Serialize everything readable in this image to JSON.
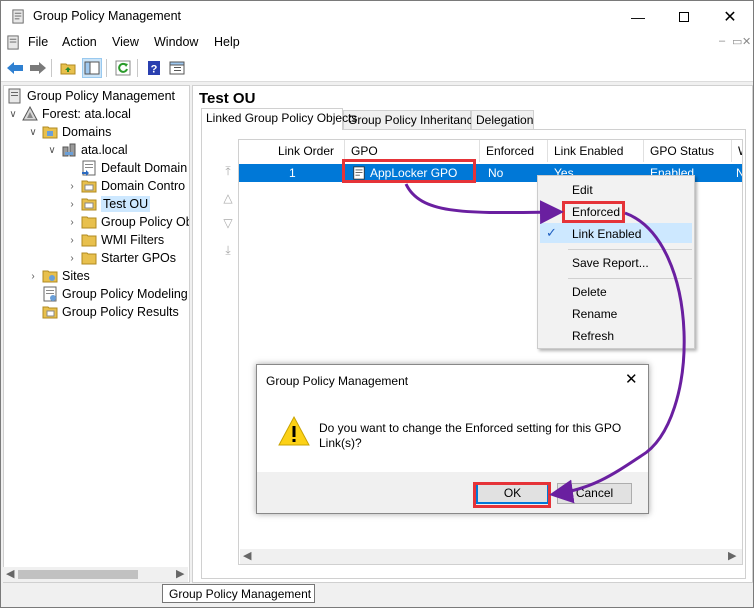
{
  "window": {
    "title": "Group Policy Management"
  },
  "menu": [
    "File",
    "Action",
    "View",
    "Window",
    "Help"
  ],
  "tree": [
    {
      "label": "Group Policy Management",
      "icon": "gpm-icon"
    },
    {
      "label": "Forest: ata.local",
      "icon": "forest-icon"
    },
    {
      "label": "Domains",
      "icon": "folder-icon"
    },
    {
      "label": "ata.local",
      "icon": "domain-icon"
    },
    {
      "label": "Default Domain",
      "icon": "gpo-link-icon"
    },
    {
      "label": "Domain Contro",
      "icon": "ou-icon"
    },
    {
      "label": "Test OU",
      "icon": "ou-icon"
    },
    {
      "label": "Group Policy Ob",
      "icon": "folder-icon"
    },
    {
      "label": "WMI Filters",
      "icon": "folder-icon"
    },
    {
      "label": "Starter GPOs",
      "icon": "folder-icon"
    },
    {
      "label": "Sites",
      "icon": "sites-icon"
    },
    {
      "label": "Group Policy Modeling",
      "icon": "modeling-icon"
    },
    {
      "label": "Group Policy Results",
      "icon": "results-icon"
    }
  ],
  "right": {
    "title": "Test OU",
    "tabs": [
      "Linked Group Policy Objects",
      "Group Policy Inheritance",
      "Delegation"
    ],
    "columns": [
      "Link Order",
      "GPO",
      "Enforced",
      "Link Enabled",
      "GPO Status",
      "W"
    ],
    "row": {
      "link_order": "1",
      "gpo": "AppLocker GPO",
      "enforced": "No",
      "link_enabled": "Yes",
      "gpo_status": "Enabled",
      "w": "N"
    }
  },
  "context_menu": {
    "items": [
      "Edit",
      "Enforced",
      "Link Enabled",
      "Save Report...",
      "Delete",
      "Rename",
      "Refresh"
    ],
    "checked": "Link Enabled"
  },
  "dialog": {
    "title": "Group Policy Management",
    "message": "Do you want to change the Enforced setting for this GPO Link(s)?",
    "ok": "OK",
    "cancel": "Cancel"
  },
  "tooltip": "Group Policy Management",
  "colors": {
    "selection": "#0078d7",
    "highlight": "#e53338",
    "annotation": "#6a1fa0",
    "tree_selection": "#cde8ff"
  }
}
